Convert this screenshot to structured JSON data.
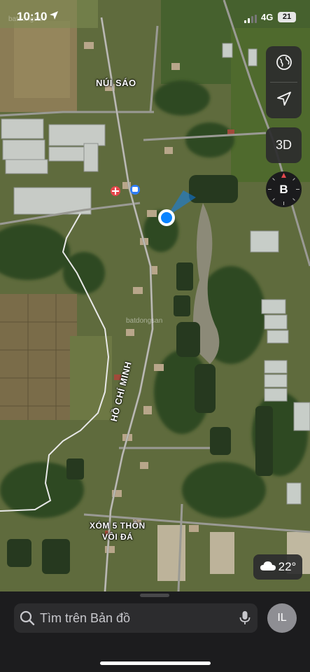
{
  "status_bar": {
    "time": "10:10",
    "network": "4G",
    "battery": "21"
  },
  "map": {
    "labels": {
      "place_nui_sao": "NÚI SÁO",
      "road": "HỒ CHÍ MINH",
      "hamlet_line1": "XÓM 5 THÔN",
      "hamlet_line2": "VÔI ĐÁ"
    },
    "watermark": "batdongsan",
    "watermark_top": "batdongsan"
  },
  "controls": {
    "map_mode_icon": "globe-icon",
    "locate_icon": "location-arrow-icon",
    "button_3d": "3D",
    "compass_letter": "B"
  },
  "weather": {
    "icon": "cloud-icon",
    "temperature": "22°"
  },
  "search": {
    "placeholder": "Tìm trên Bản đồ"
  },
  "profile": {
    "initials": "IL"
  },
  "colors": {
    "user_location": "#0a84ff",
    "panel_bg": "#2c2c2e",
    "sheet_bg": "#1c1c1e"
  }
}
